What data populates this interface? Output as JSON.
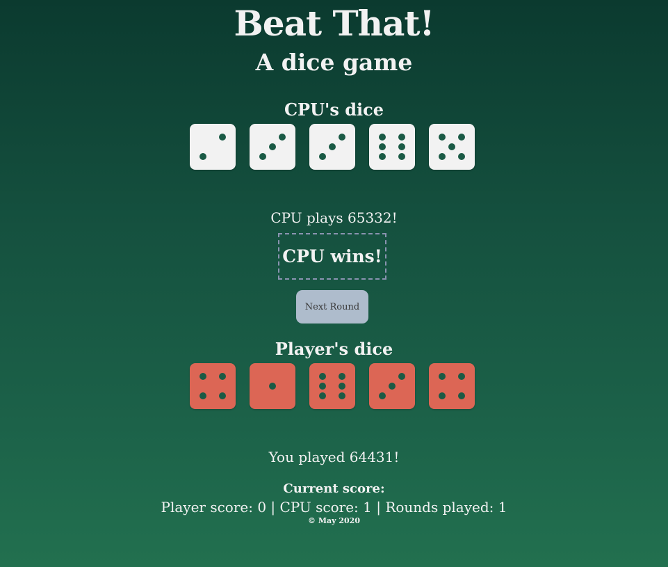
{
  "header": {
    "title": "Beat That!",
    "subtitle": "A dice game"
  },
  "cpu": {
    "section_title": "CPU's dice",
    "dice": [
      2,
      3,
      3,
      6,
      5
    ],
    "plays_text": "CPU plays 65332!"
  },
  "result": {
    "text": "CPU wins!"
  },
  "controls": {
    "next_round_label": "Next Round"
  },
  "player": {
    "section_title": "Player's dice",
    "dice": [
      4,
      1,
      6,
      3,
      4
    ],
    "played_text": "You played 64431!"
  },
  "score": {
    "heading": "Current score:",
    "line": "Player score: 0 | CPU score: 1 | Rounds played: 1"
  },
  "footer": {
    "text": "© May 2020"
  },
  "colors": {
    "cpu_die": "#f2f2f2",
    "player_die": "#dc6655",
    "pip": "#1a5a45",
    "button": "#aebccc"
  }
}
